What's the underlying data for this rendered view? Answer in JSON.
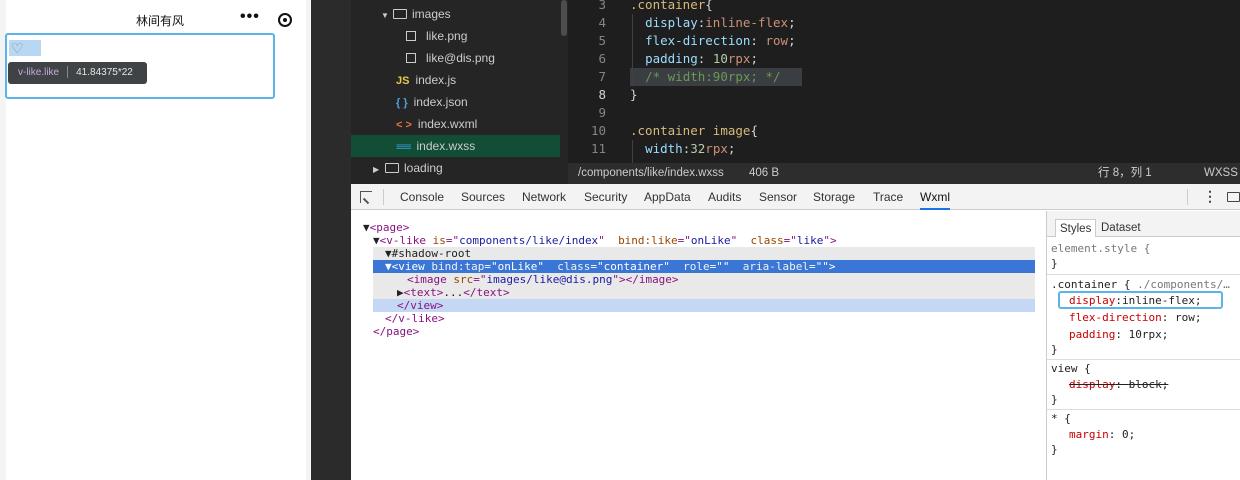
{
  "simulator": {
    "title": "林间有风",
    "tooltip_selector": "v-like.like",
    "tooltip_size": "41.84375*22"
  },
  "file_tree": {
    "items": [
      {
        "label": "images"
      },
      {
        "label": "like.png"
      },
      {
        "label": "like@dis.png"
      },
      {
        "label": "index.js"
      },
      {
        "label": "index.json"
      },
      {
        "label": "index.wxml"
      },
      {
        "label": "index.wxss"
      },
      {
        "label": "loading"
      }
    ],
    "icons": {
      "js": "JS",
      "json": "{ }",
      "wxml": "< >",
      "wxss": "≡≡≡"
    }
  },
  "editor": {
    "lines": [
      {
        "num": "3",
        "parts": [
          {
            "t": ".container",
            "c": "c-sel"
          },
          {
            "t": "{",
            "c": "c-punc"
          }
        ]
      },
      {
        "num": "4",
        "parts": [
          {
            "t": "  ",
            "c": "c-punc"
          },
          {
            "t": "display",
            "c": "c-prop"
          },
          {
            "t": ":",
            "c": "c-punc"
          },
          {
            "t": "inline-flex",
            "c": "c-val"
          },
          {
            "t": ";",
            "c": "c-punc"
          }
        ]
      },
      {
        "num": "5",
        "parts": [
          {
            "t": "  ",
            "c": "c-punc"
          },
          {
            "t": "flex-direction",
            "c": "c-prop"
          },
          {
            "t": ": ",
            "c": "c-punc"
          },
          {
            "t": "row",
            "c": "c-val"
          },
          {
            "t": ";",
            "c": "c-punc"
          }
        ]
      },
      {
        "num": "6",
        "parts": [
          {
            "t": "  ",
            "c": "c-punc"
          },
          {
            "t": "padding",
            "c": "c-prop"
          },
          {
            "t": ": ",
            "c": "c-punc"
          },
          {
            "t": "10",
            "c": "c-num"
          },
          {
            "t": "rpx",
            "c": "c-unit"
          },
          {
            "t": ";",
            "c": "c-punc"
          }
        ]
      },
      {
        "num": "7",
        "parts": [
          {
            "t": "  ",
            "c": "c-punc"
          },
          {
            "t": "/* width:90rpx; */",
            "c": "c-com"
          }
        ]
      },
      {
        "num": "8",
        "parts": [
          {
            "t": "}",
            "c": "c-punc"
          }
        ]
      },
      {
        "num": "9",
        "parts": []
      },
      {
        "num": "10",
        "parts": [
          {
            "t": ".container ",
            "c": "c-sel"
          },
          {
            "t": "image",
            "c": "c-tag"
          },
          {
            "t": "{",
            "c": "c-punc"
          }
        ]
      },
      {
        "num": "11",
        "parts": [
          {
            "t": "  ",
            "c": "c-punc"
          },
          {
            "t": "width",
            "c": "c-prop"
          },
          {
            "t": ":",
            "c": "c-punc"
          },
          {
            "t": "32",
            "c": "c-num"
          },
          {
            "t": "rpx",
            "c": "c-unit"
          },
          {
            "t": ";",
            "c": "c-punc"
          }
        ]
      }
    ]
  },
  "status_bar": {
    "path": "/components/like/index.wxss",
    "size": "406 B",
    "position": "行 8，列 1",
    "lang": "WXSS"
  },
  "devtools": {
    "tabs": [
      "Console",
      "Sources",
      "Network",
      "Security",
      "AppData",
      "Audits",
      "Sensor",
      "Storage",
      "Trace",
      "Wxml"
    ],
    "active_tab": "Wxml",
    "dom_lines": [
      {
        "parts": [
          {
            "t": "▼",
            "c": "t-plain"
          },
          {
            "t": "<page>",
            "c": "t-tag"
          }
        ]
      },
      {
        "parts": [
          {
            "t": "▼",
            "c": "t-plain"
          },
          {
            "t": "<v-like ",
            "c": "t-tag"
          },
          {
            "t": "is",
            "c": "t-attr"
          },
          {
            "t": "=\"",
            "c": "t-tag"
          },
          {
            "t": "components/like/index",
            "c": "t-val"
          },
          {
            "t": "\"  ",
            "c": "t-tag"
          },
          {
            "t": "bind:like",
            "c": "t-attr"
          },
          {
            "t": "=\"",
            "c": "t-tag"
          },
          {
            "t": "onLike",
            "c": "t-val"
          },
          {
            "t": "\"  ",
            "c": "t-tag"
          },
          {
            "t": "class",
            "c": "t-attr"
          },
          {
            "t": "=\"",
            "c": "t-tag"
          },
          {
            "t": "like",
            "c": "t-val"
          },
          {
            "t": "\">",
            "c": "t-tag"
          }
        ]
      },
      {
        "parts": [
          {
            "t": "▼",
            "c": "t-plain"
          },
          {
            "t": "#shadow-root",
            "c": "t-plain"
          }
        ]
      },
      {
        "parts": [
          {
            "t": "▼",
            "c": "t-plain"
          },
          {
            "t": "<view ",
            "c": "t-tag"
          },
          {
            "t": "bind:tap",
            "c": "t-attr"
          },
          {
            "t": "=\"",
            "c": "t-tag"
          },
          {
            "t": "onLike",
            "c": "t-val"
          },
          {
            "t": "\"  ",
            "c": "t-tag"
          },
          {
            "t": "class",
            "c": "t-attr"
          },
          {
            "t": "=\"",
            "c": "t-tag"
          },
          {
            "t": "container",
            "c": "t-val"
          },
          {
            "t": "\"  ",
            "c": "t-tag"
          },
          {
            "t": "role",
            "c": "t-attr"
          },
          {
            "t": "=\"\"  ",
            "c": "t-tag"
          },
          {
            "t": "aria-label",
            "c": "t-attr"
          },
          {
            "t": "=\"\">",
            "c": "t-tag"
          }
        ]
      },
      {
        "parts": [
          {
            "t": "<image ",
            "c": "t-tag"
          },
          {
            "t": "src",
            "c": "t-attr"
          },
          {
            "t": "=\"",
            "c": "t-tag"
          },
          {
            "t": "images/like@dis.png",
            "c": "t-val"
          },
          {
            "t": "\"></image>",
            "c": "t-tag"
          }
        ]
      },
      {
        "parts": [
          {
            "t": "▶",
            "c": "t-plain"
          },
          {
            "t": "<text>",
            "c": "t-tag"
          },
          {
            "t": "...",
            "c": "t-plain"
          },
          {
            "t": "</text>",
            "c": "t-tag"
          }
        ]
      },
      {
        "parts": [
          {
            "t": "</view>",
            "c": "t-tag"
          }
        ]
      },
      {
        "parts": [
          {
            "t": "</v-like>",
            "c": "t-tag"
          }
        ]
      },
      {
        "parts": [
          {
            "t": "</page>",
            "c": "t-tag"
          }
        ]
      }
    ]
  },
  "styles_pane": {
    "tabs": [
      "Styles",
      "Dataset"
    ],
    "element_style": "element.style {",
    "rule1_selector": ".container {",
    "rule1_source": "./components/…",
    "rule1_props": [
      {
        "prop": "display",
        "val": "inline-flex;"
      },
      {
        "prop": "flex-direction",
        "val": "row;"
      },
      {
        "prop": "padding",
        "val": "10rpx;"
      }
    ],
    "rule2_selector": "view {",
    "rule2_prop": "display",
    "rule2_val": "block;",
    "rule3_selector": "* {",
    "rule3_prop": "margin",
    "rule3_val": "0;",
    "close": "}"
  }
}
